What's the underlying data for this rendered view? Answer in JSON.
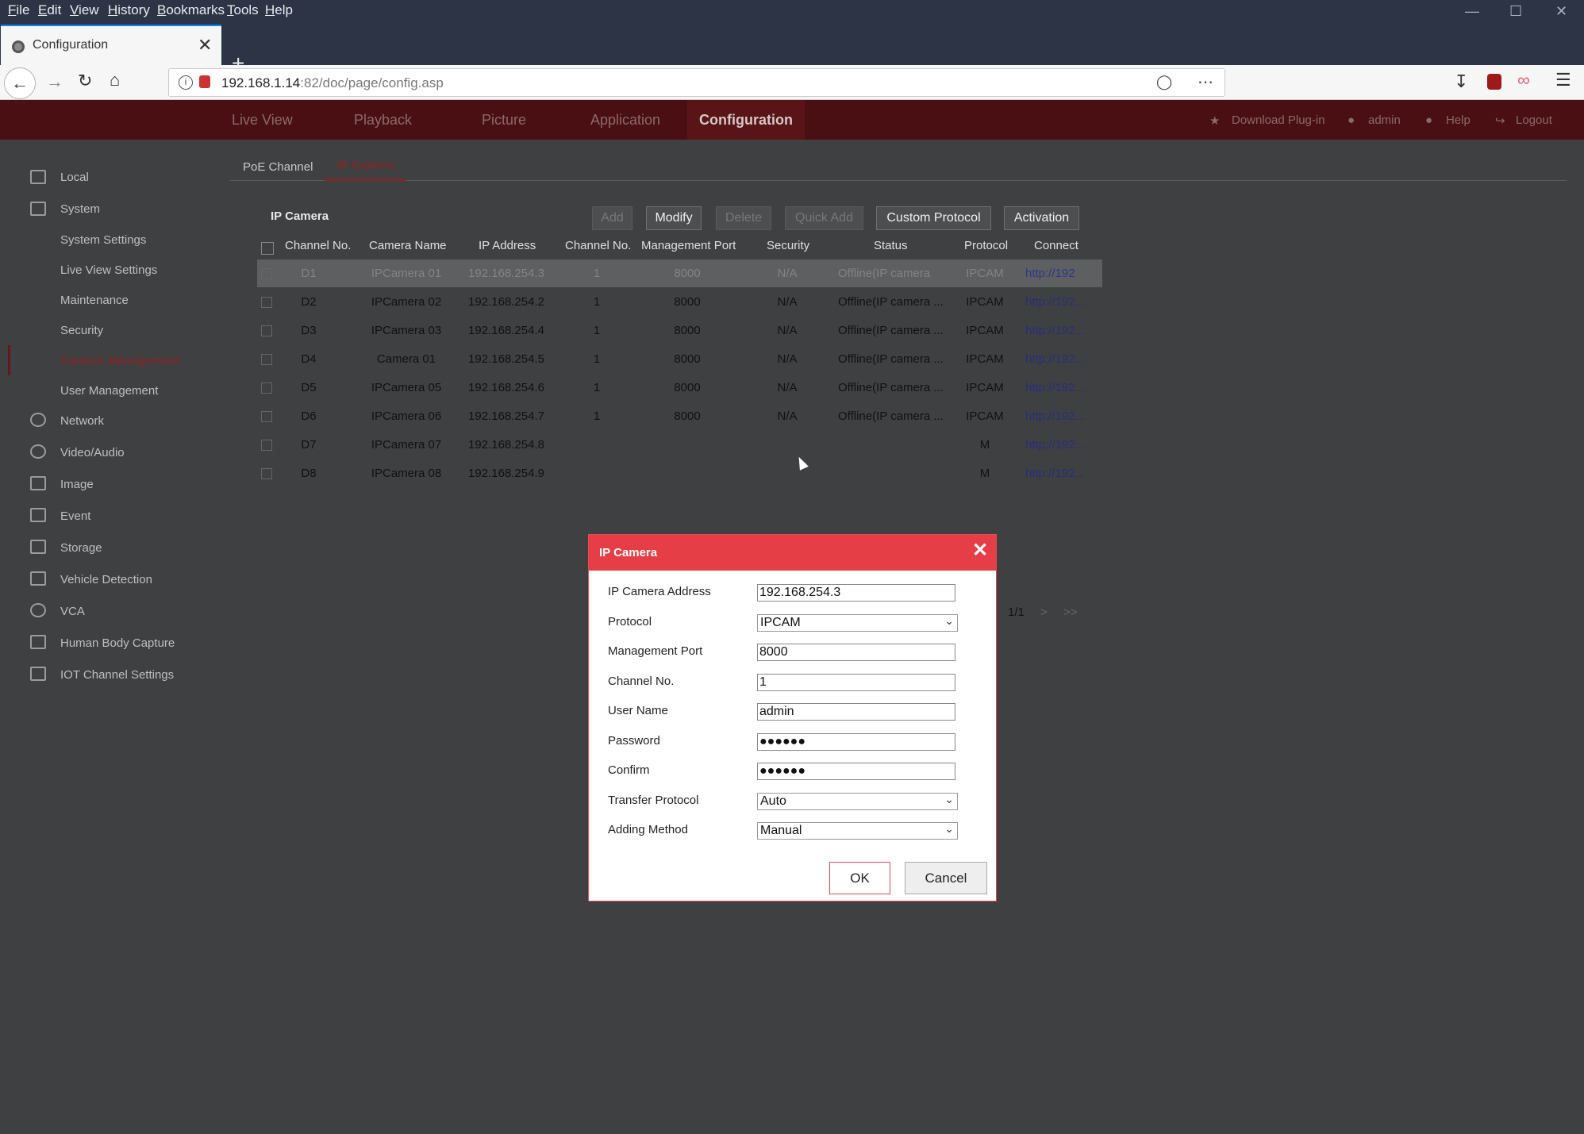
{
  "browser": {
    "menu": [
      "File",
      "Edit",
      "View",
      "History",
      "Bookmarks",
      "Tools",
      "Help"
    ],
    "tab_title": "Configuration",
    "url_host": "192.168.1.14",
    "url_rest": ":82/doc/page/config.asp"
  },
  "app": {
    "nav": [
      "Live View",
      "Playback",
      "Picture",
      "Application",
      "Configuration"
    ],
    "active_nav": "Configuration",
    "right": {
      "download": "Download Plug-in",
      "user": "admin",
      "help": "Help",
      "logout": "Logout"
    }
  },
  "sidebar": {
    "items": [
      {
        "label": "Local",
        "icon": "monitor-icon"
      },
      {
        "label": "System",
        "icon": "system-icon"
      },
      {
        "label": "System Settings"
      },
      {
        "label": "Live View Settings"
      },
      {
        "label": "Maintenance"
      },
      {
        "label": "Security"
      },
      {
        "label": "Camera Management"
      },
      {
        "label": "User Management"
      },
      {
        "label": "Network",
        "icon": "globe-icon"
      },
      {
        "label": "Video/Audio",
        "icon": "microphone-icon"
      },
      {
        "label": "Image",
        "icon": "image-icon"
      },
      {
        "label": "Event",
        "icon": "calendar-icon"
      },
      {
        "label": "Storage",
        "icon": "storage-icon"
      },
      {
        "label": "Vehicle Detection",
        "icon": "vehicle-icon"
      },
      {
        "label": "VCA",
        "icon": "vca-icon"
      },
      {
        "label": "Human Body Capture",
        "icon": "human-icon"
      },
      {
        "label": "IOT Channel Settings",
        "icon": "iot-icon"
      }
    ],
    "selected": "Camera Management"
  },
  "subtabs": [
    "PoE Channel",
    "IP Camera"
  ],
  "section_title": "IP Camera",
  "toolbar": [
    "Add",
    "Modify",
    "Delete",
    "Quick Add",
    "Custom Protocol",
    "Activation"
  ],
  "table": {
    "headers": [
      "Channel No.",
      "Camera Name",
      "IP Address",
      "Channel No.",
      "Management Port",
      "Security",
      "Status",
      "Protocol",
      "Connect"
    ],
    "rows": [
      [
        "D1",
        "IPCamera 01",
        "192.168.254.3",
        "1",
        "8000",
        "N/A",
        "Offline(IP camera",
        "IPCAM",
        "http://192"
      ],
      [
        "D2",
        "IPCamera 02",
        "192.168.254.2",
        "1",
        "8000",
        "N/A",
        "Offline(IP camera ...",
        "IPCAM",
        "http://192..."
      ],
      [
        "D3",
        "IPCamera 03",
        "192.168.254.4",
        "1",
        "8000",
        "N/A",
        "Offline(IP camera ...",
        "IPCAM",
        "http://192..."
      ],
      [
        "D4",
        "Camera 01",
        "192.168.254.5",
        "1",
        "8000",
        "N/A",
        "Offline(IP camera ...",
        "IPCAM",
        "http://192..."
      ],
      [
        "D5",
        "IPCamera 05",
        "192.168.254.6",
        "1",
        "8000",
        "N/A",
        "Offline(IP camera ...",
        "IPCAM",
        "http://192..."
      ],
      [
        "D6",
        "IPCamera 06",
        "192.168.254.7",
        "1",
        "8000",
        "N/A",
        "Offline(IP camera ...",
        "IPCAM",
        "http://192..."
      ],
      [
        "D7",
        "IPCamera 07",
        "192.168.254.8",
        "",
        "",
        "",
        "",
        "M",
        "http://192..."
      ],
      [
        "D8",
        "IPCamera 08",
        "192.168.254.9",
        "",
        "",
        "",
        "",
        "M",
        "http://192..."
      ]
    ]
  },
  "pager": {
    "page": "1/1",
    "next": ">",
    "last": ">>"
  },
  "dialog": {
    "title": "IP Camera",
    "fields": [
      {
        "label": "IP Camera Address",
        "value": "192.168.254.3",
        "type": "input"
      },
      {
        "label": "Protocol",
        "value": "IPCAM",
        "type": "select"
      },
      {
        "label": "Management Port",
        "value": "8000",
        "type": "input"
      },
      {
        "label": "Channel No.",
        "value": "1",
        "type": "input"
      },
      {
        "label": "User Name",
        "value": "admin",
        "type": "input"
      },
      {
        "label": "Password",
        "value": "●●●●●●",
        "type": "input"
      },
      {
        "label": "Confirm",
        "value": "●●●●●●",
        "type": "input"
      },
      {
        "label": "Transfer Protocol",
        "value": "Auto",
        "type": "select"
      },
      {
        "label": "Adding Method",
        "value": "Manual",
        "type": "select"
      }
    ],
    "ok": "OK",
    "cancel": "Cancel"
  }
}
